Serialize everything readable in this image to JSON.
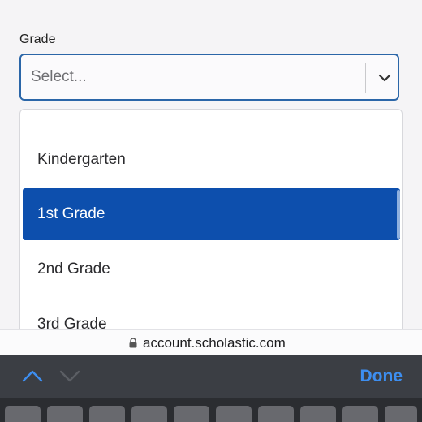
{
  "form": {
    "grade_label": "Grade",
    "select_placeholder": "Select..."
  },
  "dropdown": {
    "options": [
      {
        "label": "Kindergarten",
        "selected": false
      },
      {
        "label": "1st Grade",
        "selected": true
      },
      {
        "label": "2nd Grade",
        "selected": false
      },
      {
        "label": "3rd Grade",
        "selected": false
      }
    ]
  },
  "browser": {
    "url": "account.scholastic.com"
  },
  "keyboard_bar": {
    "done_label": "Done"
  },
  "icons": {
    "select_chevron": "chevron-down-icon",
    "url_lock": "lock-icon",
    "previous_field": "chevron-up-icon",
    "next_field": "chevron-down-icon"
  },
  "colors": {
    "select_border": "#2b66a8",
    "selected_option_bg": "#0d4fad",
    "done_text": "#3d8ef0",
    "accessory_bar_bg": "#3b3e44"
  }
}
